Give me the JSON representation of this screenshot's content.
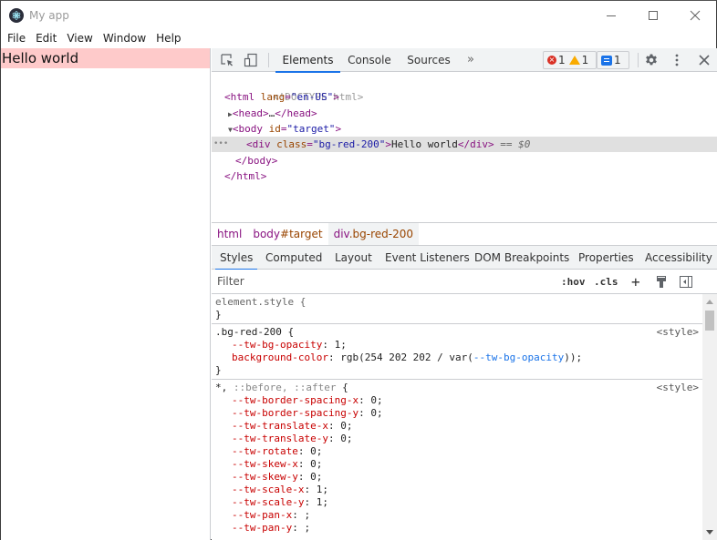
{
  "window": {
    "title": "My app",
    "controls": {
      "minimize": "minimize",
      "maximize": "maximize",
      "close": "close"
    }
  },
  "menubar": [
    "File",
    "Edit",
    "View",
    "Window",
    "Help"
  ],
  "page": {
    "content_text": "Hello world",
    "content_bg": "#fecaca"
  },
  "devtools": {
    "tabs": [
      "Elements",
      "Console",
      "Sources"
    ],
    "active_tab": "Elements",
    "more_tabs": "»",
    "errors": "1",
    "warnings": "1",
    "messages": "1",
    "tree": [
      {
        "text": "<!DOCTYPE html>"
      },
      {
        "tag_open": "<html",
        "attr": " lang",
        "eq": "=",
        "val": "\"en-US\"",
        "close": ">"
      },
      {
        "tag": "<head>",
        "ellipsis": "…",
        "end": "</head>"
      },
      {
        "tag_open": "<body",
        "attr": " id",
        "eq": "=",
        "val": "\"target\"",
        "close": ">"
      },
      {
        "tag_open": "<div",
        "attr": " class",
        "eq": "=",
        "val": "\"bg-red-200\"",
        "close": ">",
        "text": "Hello world",
        "end": "</div>",
        "marker": " == $0"
      },
      {
        "end": "</body>"
      },
      {
        "end": "</html>"
      }
    ],
    "selected_dots": "•••",
    "breadcrumbs": [
      {
        "tag": "html"
      },
      {
        "tag": "body",
        "suffix": "#target"
      },
      {
        "tag": "div",
        "suffix": ".bg-red-200"
      }
    ],
    "subtabs": [
      "Styles",
      "Computed",
      "Layout",
      "Event Listeners",
      "DOM Breakpoints",
      "Properties",
      "Accessibility"
    ],
    "active_subtab": "Styles",
    "filter_placeholder": "Filter",
    "hov": ":hov",
    "cls": ".cls",
    "plus": "+",
    "rules": [
      {
        "selector": "element.style {",
        "close": "}",
        "props": []
      },
      {
        "selector": ".bg-red-200 {",
        "source": "<style>",
        "close": "}",
        "props": [
          {
            "name": "--tw-bg-opacity",
            "value": " 1;"
          },
          {
            "name": "background-color",
            "value": " rgb(254 202 202 / var(",
            "var": "--tw-bg-opacity",
            "value_end": "));"
          }
        ]
      },
      {
        "selector": "*,",
        "pseudo": " ::before, ::after",
        "brace": " {",
        "source": "<style>",
        "props": [
          {
            "name": "--tw-border-spacing-x",
            "value": " 0;"
          },
          {
            "name": "--tw-border-spacing-y",
            "value": " 0;"
          },
          {
            "name": "--tw-translate-x",
            "value": " 0;"
          },
          {
            "name": "--tw-translate-y",
            "value": " 0;"
          },
          {
            "name": "--tw-rotate",
            "value": " 0;"
          },
          {
            "name": "--tw-skew-x",
            "value": " 0;"
          },
          {
            "name": "--tw-skew-y",
            "value": " 0;"
          },
          {
            "name": "--tw-scale-x",
            "value": " 1;"
          },
          {
            "name": "--tw-scale-y",
            "value": " 1;"
          },
          {
            "name": "--tw-pan-x",
            "value": " ;"
          },
          {
            "name": "--tw-pan-y",
            "value": " ;"
          }
        ]
      }
    ]
  }
}
